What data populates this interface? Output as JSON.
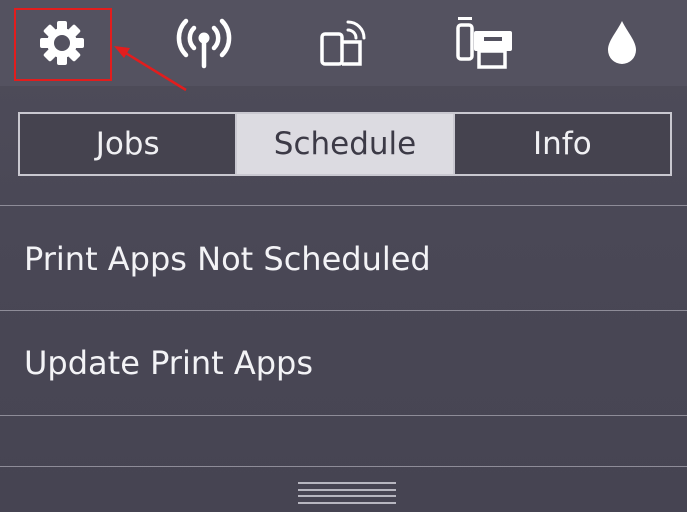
{
  "top_icons": [
    {
      "name": "settings-icon",
      "highlighted": true
    },
    {
      "name": "wireless-icon"
    },
    {
      "name": "wifi-direct-icon"
    },
    {
      "name": "web-services-icon"
    },
    {
      "name": "ink-icon"
    }
  ],
  "annotation": {
    "box_color": "#e21d1d",
    "arrow_color": "#e21d1d"
  },
  "tabs": [
    {
      "label": "Jobs",
      "active": false
    },
    {
      "label": "Schedule",
      "active": true
    },
    {
      "label": "Info",
      "active": false
    }
  ],
  "list": {
    "items": [
      {
        "label": "Print Apps Not Scheduled"
      },
      {
        "label": "Update Print Apps"
      }
    ]
  },
  "colors": {
    "background": "#4a4856",
    "active_tab": "#dcdbe1",
    "text": "#f3f3f6"
  }
}
